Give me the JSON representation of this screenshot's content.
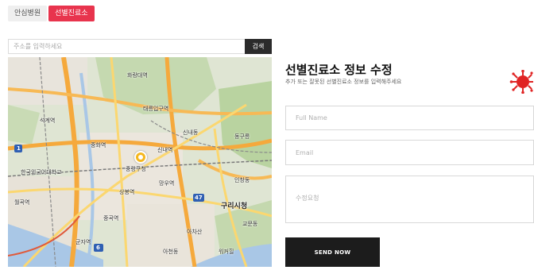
{
  "tabs": [
    {
      "label": "안심병원",
      "active": false
    },
    {
      "label": "선별진료소",
      "active": true
    }
  ],
  "search": {
    "placeholder": "주소를 입력하세요",
    "button_label": "검색"
  },
  "map": {
    "labels": {
      "center": "중랑구청",
      "guri": "구리시청",
      "sindae": "신내역",
      "mangwu": "망우역",
      "junghwa": "중화역",
      "seokgye": "석계역",
      "hankuk": "한국외국어대학교",
      "wolgok": "월곡역",
      "sangbong": "상봉역",
      "junggok": "중곡역",
      "gunja": "군자역",
      "walker": "워커힐",
      "achasan": "아차산",
      "ahan": "아천동",
      "inchang": "인창동",
      "gyomun": "교문동",
      "dongguneung": "동구릉",
      "hwarang": "화랑대역",
      "taereung": "태릉입구역",
      "sinnae": "신내동"
    },
    "roads": {
      "r1": "1",
      "r2": "47",
      "r3": "6"
    }
  },
  "form": {
    "title": "선별진료소 정보 수정",
    "subtitle": "추가 또는 잘못된 선별진료소 정보를 입력해주세요",
    "name_placeholder": "Full Name",
    "email_placeholder": "Email",
    "request_placeholder": "수정요청",
    "send_label": "SEND NOW"
  },
  "colors": {
    "accent": "#e8344d",
    "dark": "#1c1c1c",
    "virus": "#e02424"
  }
}
